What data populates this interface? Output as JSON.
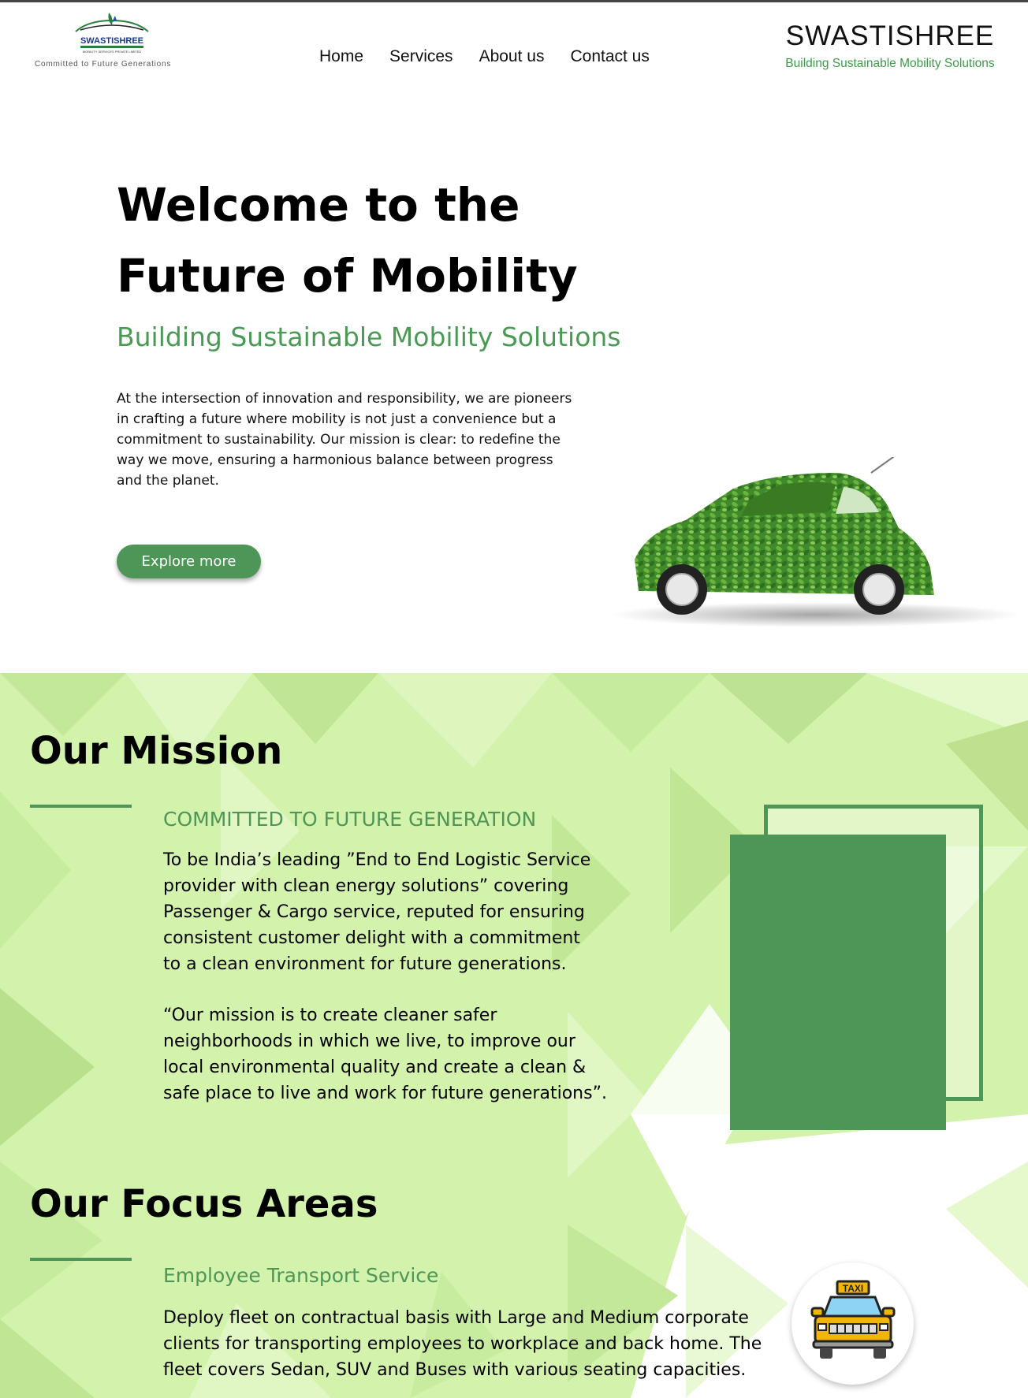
{
  "header": {
    "logo_text": "SWASTISHREE",
    "logo_subtext": "MOBILITY SERVICES PRIVATE LIMITED",
    "logo_tagline": "Committed to Future Generations",
    "nav": [
      "Home",
      "Services",
      "About us",
      "Contact us"
    ],
    "brand_name": "SWASTISHREE",
    "brand_subtitle": "Building Sustainable Mobility Solutions"
  },
  "hero": {
    "title_line1": "Welcome to the",
    "title_line2": "Future of Mobility",
    "subtitle": "Building Sustainable Mobility Solutions",
    "body": "At the intersection of innovation and responsibility, we are pioneers in crafting a future where mobility is not just a convenience but a commitment to sustainability. Our mission is clear: to redefine the way we move, ensuring a harmonious balance between progress and the planet.",
    "cta": "Explore more"
  },
  "mission": {
    "heading": "Our Mission",
    "label": "COMMITTED TO FUTURE GENERATION",
    "para1": [
      "To be India’s leading ”End to End Logistic Service",
      "provider with clean energy solutions” covering",
      "Passenger & Cargo service, reputed for ensuring",
      "consistent customer delight with a commitment",
      "to a clean environment for future generations."
    ],
    "para2": [
      "“Our mission is to create cleaner safer",
      "neighborhoods in which we live, to improve our",
      "local environmental quality and create a clean &",
      "safe place to live and work for future generations”."
    ]
  },
  "focus": {
    "heading": "Our Focus Areas",
    "item_title": "Employee Transport Service",
    "item_text": [
      "Deploy fleet on contractual basis with Large and Medium corporate",
      "clients for transporting employees to workplace and back home. The",
      "fleet covers Sedan, SUV and Buses with various seating capacities."
    ],
    "taxi_sign": "TAXI"
  },
  "colors": {
    "accent": "#4e9657",
    "section_bg": "#d3f2ab"
  },
  "icons": [
    "logo-car-icon",
    "leaf-car-image",
    "taxi-icon"
  ]
}
